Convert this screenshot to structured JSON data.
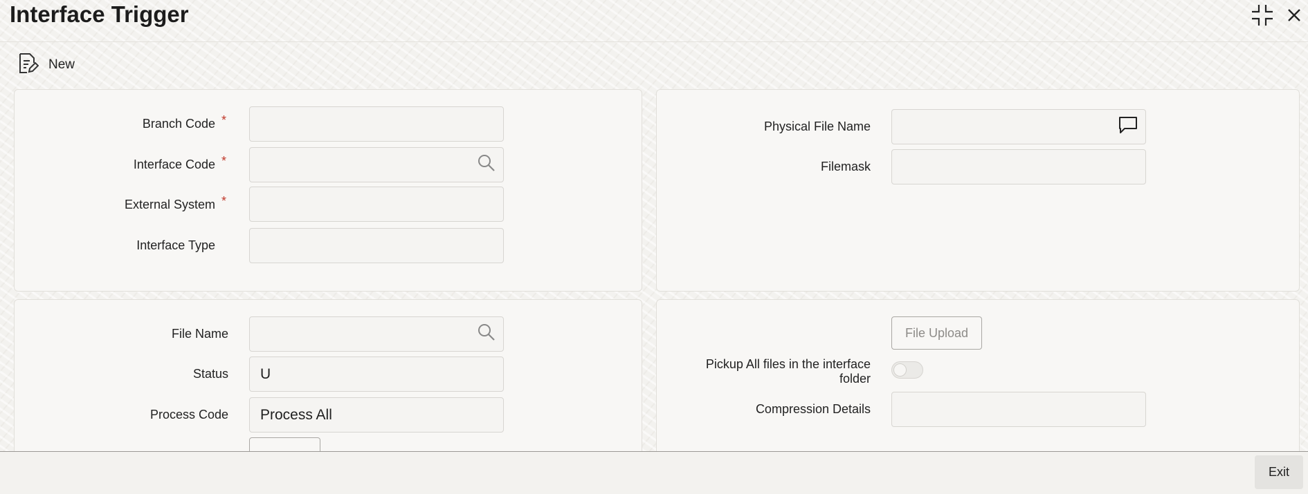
{
  "window": {
    "title": "Interface Trigger",
    "minimize_icon": "collapse-icon",
    "close_icon": "close-icon"
  },
  "toolbar": {
    "new_label": "New",
    "new_icon": "new-document-icon"
  },
  "main_panel": {
    "branch_code": {
      "label": "Branch Code",
      "required": "*",
      "value": ""
    },
    "interface_code": {
      "label": "Interface Code",
      "required": "*",
      "value": ""
    },
    "external_system": {
      "label": "External System",
      "required": "*",
      "value": ""
    },
    "interface_type": {
      "label": "Interface Type",
      "value": ""
    }
  },
  "file_panel": {
    "physical_file_name": {
      "label": "Physical File Name",
      "value": ""
    },
    "filemask": {
      "label": "Filemask",
      "value": ""
    }
  },
  "process_panel": {
    "file_name": {
      "label": "File Name",
      "value": ""
    },
    "status": {
      "label": "Status",
      "value": "U"
    },
    "process_code": {
      "label": "Process Code",
      "value": "Process All"
    }
  },
  "upload_panel": {
    "file_upload_label": "File Upload",
    "pickup_all_label_line1": "Pickup All files in the interface",
    "pickup_all_label_line2": "folder",
    "pickup_all_enabled": false,
    "compression_details": {
      "label": "Compression Details",
      "value": ""
    }
  },
  "footer": {
    "exit_label": "Exit"
  },
  "colors": {
    "required": "#c0392b",
    "panel_bg": "#f8f7f5",
    "field_border": "#d7d5d1"
  }
}
